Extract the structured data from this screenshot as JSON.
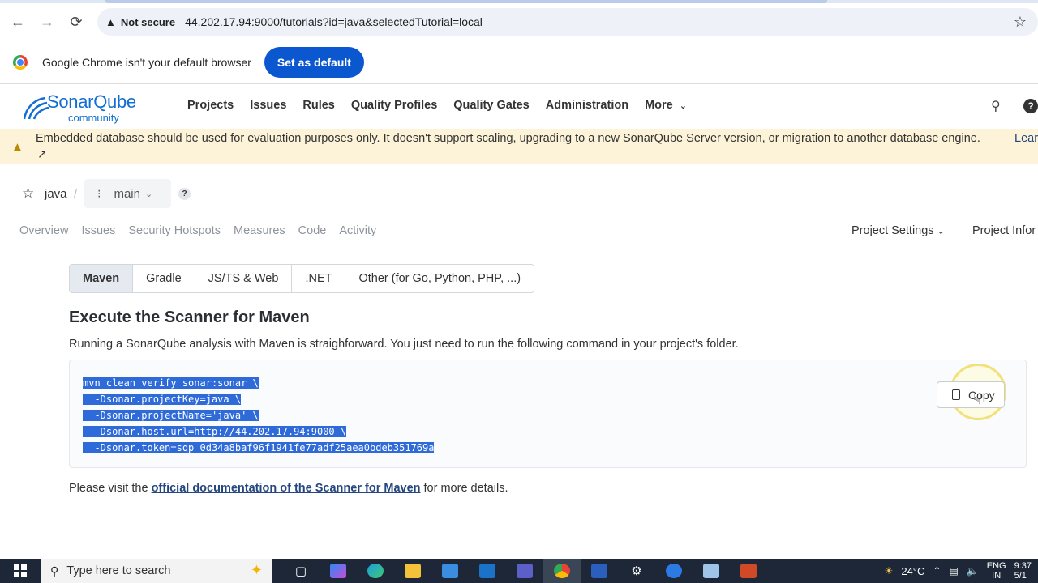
{
  "browser": {
    "security_label": "Not secure",
    "url": "44.202.17.94:9000/tutorials?id=java&selectedTutorial=local",
    "infobar_message": "Google Chrome isn't your default browser",
    "set_default_label": "Set as default"
  },
  "header": {
    "brand": "SonarQube",
    "edition": "community",
    "nav": [
      "Projects",
      "Issues",
      "Rules",
      "Quality Profiles",
      "Quality Gates",
      "Administration",
      "More"
    ],
    "help": "?"
  },
  "warning": {
    "text": "Embedded database should be used for evaluation purposes only. It doesn't support scaling, upgrading to a new SonarQube Server version, or migration to another database engine.",
    "link": "Lear"
  },
  "project": {
    "name": "java",
    "separator": "/",
    "branch": "main",
    "help": "?",
    "tabs": [
      "Overview",
      "Issues",
      "Security Hotspots",
      "Measures",
      "Code",
      "Activity"
    ],
    "settings": "Project Settings",
    "info": "Project Infor"
  },
  "tutorial": {
    "build_tabs": [
      "Maven",
      "Gradle",
      "JS/TS & Web",
      ".NET",
      "Other (for Go, Python, PHP, ...)"
    ],
    "selected_tab": "Maven",
    "title": "Execute the Scanner for Maven",
    "intro": "Running a SonarQube analysis with Maven is straighforward. You just need to run the following command in your project's folder.",
    "code_lines": [
      "mvn clean verify sonar:sonar \\",
      "  -Dsonar.projectKey=java \\",
      "  -Dsonar.projectName='java' \\",
      "  -Dsonar.host.url=http://44.202.17.94:9000 \\",
      "  -Dsonar.token=sqp_0d34a8baf96f1941fe77adf25aea0bdeb351769a"
    ],
    "copy_label": "Copy",
    "outro_before": "Please visit the ",
    "outro_link": "official documentation of the Scanner for Maven",
    "outro_after": " for more details."
  },
  "taskbar": {
    "search_placeholder": "Type here to search",
    "temperature": "24°C",
    "lang_top": "ENG",
    "lang_bottom": "IN",
    "time": "9:37",
    "date": "5/1"
  },
  "colors": {
    "accent": "#126ed3",
    "chrome_button": "#0b57d0",
    "warning_bg": "#fdf3d8",
    "selection": "#2f6bd8"
  }
}
